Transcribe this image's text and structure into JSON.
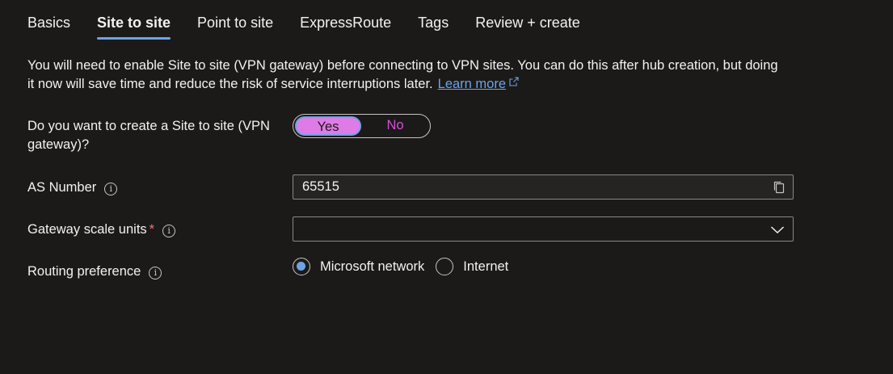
{
  "tabs": [
    {
      "label": "Basics"
    },
    {
      "label": "Site to site"
    },
    {
      "label": "Point to site"
    },
    {
      "label": "ExpressRoute"
    },
    {
      "label": "Tags"
    },
    {
      "label": "Review + create"
    }
  ],
  "active_tab": "Site to site",
  "info": {
    "text": "You will need to enable Site to site (VPN gateway) before connecting to VPN sites. You can do this after hub creation, but doing it now will save time and reduce the risk of service interruptions later.",
    "link_label": "Learn more",
    "link_icon": "external-link-icon"
  },
  "create_s2s": {
    "label": "Do you want to create a Site to site (VPN gateway)?",
    "options": [
      "Yes",
      "No"
    ],
    "selected": "Yes"
  },
  "as_number": {
    "label": "AS Number",
    "value": "65515",
    "icon": "copy-icon"
  },
  "gateway_scale_units": {
    "label": "Gateway scale units",
    "required_marker": "*",
    "value": ""
  },
  "routing_preference": {
    "label": "Routing preference",
    "options": [
      "Microsoft network",
      "Internet"
    ],
    "selected": "Microsoft network"
  },
  "colors": {
    "background": "#1b1a19",
    "accent": "#6ca3e8",
    "toggle_selected": "#df7be6",
    "toggle_text": "#d94dd9",
    "required": "#f1707b"
  }
}
